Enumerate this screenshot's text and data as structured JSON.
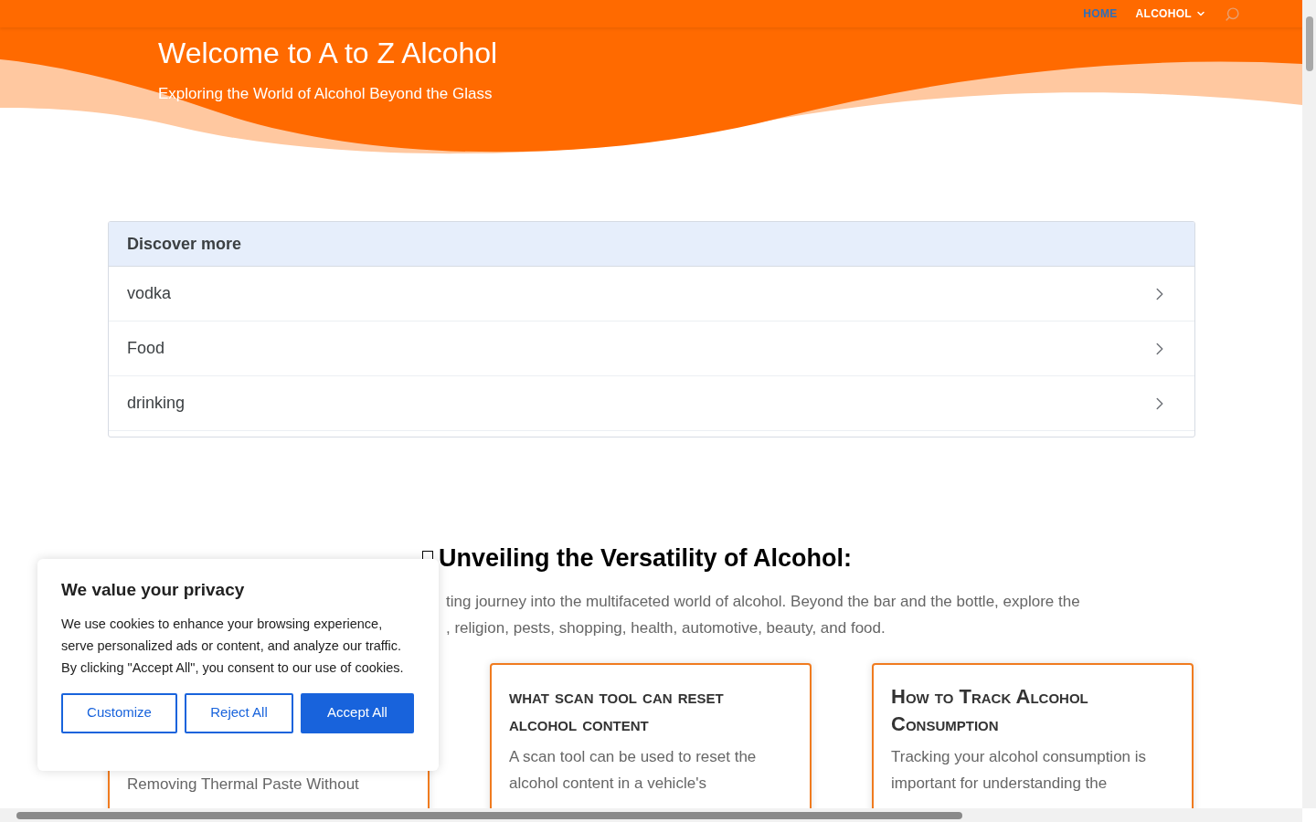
{
  "nav": {
    "items": [
      {
        "label": "HOME",
        "selected": true,
        "has_menu": false
      },
      {
        "label": "ALCOHOL",
        "selected": false,
        "has_menu": true
      }
    ]
  },
  "hero": {
    "title": "Welcome to A to Z Alcohol",
    "subtitle": "Exploring the World of Alcohol Beyond the Glass"
  },
  "discover": {
    "title": "Discover more",
    "items": [
      "vodka",
      "Food",
      "drinking"
    ]
  },
  "section": {
    "heading": "Unveiling the Versatility of Alcohol:",
    "intro_lines": [
      "ting journey into the multifaceted world of alcohol. Beyond the bar and the bottle, explore the",
      ", religion, pests, shopping, health, automotive, beauty, and food."
    ]
  },
  "cards": [
    {
      "body": "Removing Thermal Paste Without"
    },
    {
      "title": "what scan tool can reset alcohol content",
      "body": "A scan tool can be used to reset the alcohol content in a vehicle's"
    },
    {
      "title": "How to Track Alcohol Consumption",
      "body": "Tracking your alcohol consumption is important for understanding the"
    }
  ],
  "cookie_dialog": {
    "title": "We value your privacy",
    "text": "We use cookies to enhance your browsing experience, serve personalized ads or content, and analyze our traffic. By clicking \"Accept All\", you consent to our use of cookies.",
    "buttons": [
      {
        "label": "Customize",
        "kind": "outline"
      },
      {
        "label": "Reject All",
        "kind": "outline"
      },
      {
        "label": "Accept All",
        "kind": "primary"
      }
    ]
  }
}
